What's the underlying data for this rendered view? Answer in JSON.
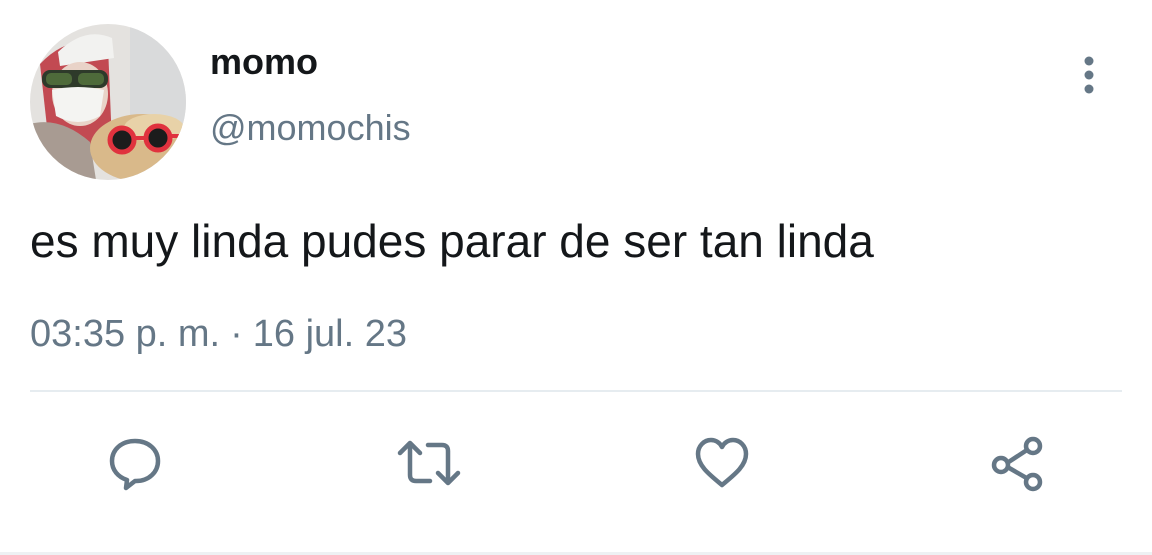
{
  "tweet": {
    "author": {
      "display_name": "momo",
      "handle": "@momochis",
      "avatar_icon": "avatar-photo"
    },
    "text": "es muy linda pudes parar de ser tan linda",
    "time": "03:35 p. m.",
    "separator": "·",
    "date": "16 jul. 23"
  },
  "actions": [
    {
      "name": "reply",
      "icon": "speech-bubble-icon"
    },
    {
      "name": "retweet",
      "icon": "retweet-icon"
    },
    {
      "name": "like",
      "icon": "heart-icon"
    },
    {
      "name": "share",
      "icon": "share-icon"
    }
  ],
  "more_icon": "vertical-ellipsis-icon",
  "colors": {
    "text": "#14171a",
    "secondary": "#657786",
    "divider": "#e6ecf0"
  }
}
